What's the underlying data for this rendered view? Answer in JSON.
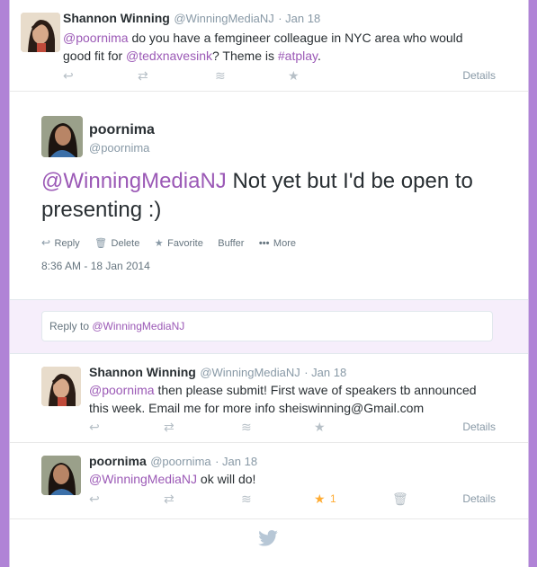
{
  "tweet1": {
    "name": "Shannon Winning",
    "handle": "@WinningMediaNJ",
    "time": "· Jan 18",
    "mention1": "@poornima",
    "text1": " do you have a femgineer colleague  in NYC area who would",
    "text2": "good fit for ",
    "mention2": "@tedxnavesink",
    "text3": "? Theme is ",
    "hashtag": "#atplay",
    "text4": ".",
    "details": "Details"
  },
  "main": {
    "name": "poornima",
    "handle": "@poornima",
    "mention": "@WinningMediaNJ",
    "text": " Not yet but I'd be open to presenting :)",
    "actions": {
      "reply": "Reply",
      "delete": "Delete",
      "favorite": "Favorite",
      "buffer": "Buffer",
      "more": "More"
    },
    "timestamp": "8:36 AM - 18 Jan 2014"
  },
  "reply_box": {
    "prefix": "Reply to ",
    "mention": "@WinningMediaNJ"
  },
  "tweet2": {
    "name": "Shannon Winning",
    "handle": "@WinningMediaNJ",
    "time": "· Jan 18",
    "mention": "@poornima",
    "text1": " then please submit! First wave of speakers tb announced",
    "text2": "this week. Email me for more info sheiswinning@Gmail.com",
    "details": "Details"
  },
  "tweet3": {
    "name": "poornima",
    "handle": "@poornima",
    "time": "· Jan 18",
    "mention": "@WinningMediaNJ",
    "text": " ok will do!",
    "fav_count": "1",
    "details": "Details"
  },
  "colors": {
    "accent": "#9b59b6",
    "background": "#b083d6",
    "star_active": "#ffac33"
  }
}
